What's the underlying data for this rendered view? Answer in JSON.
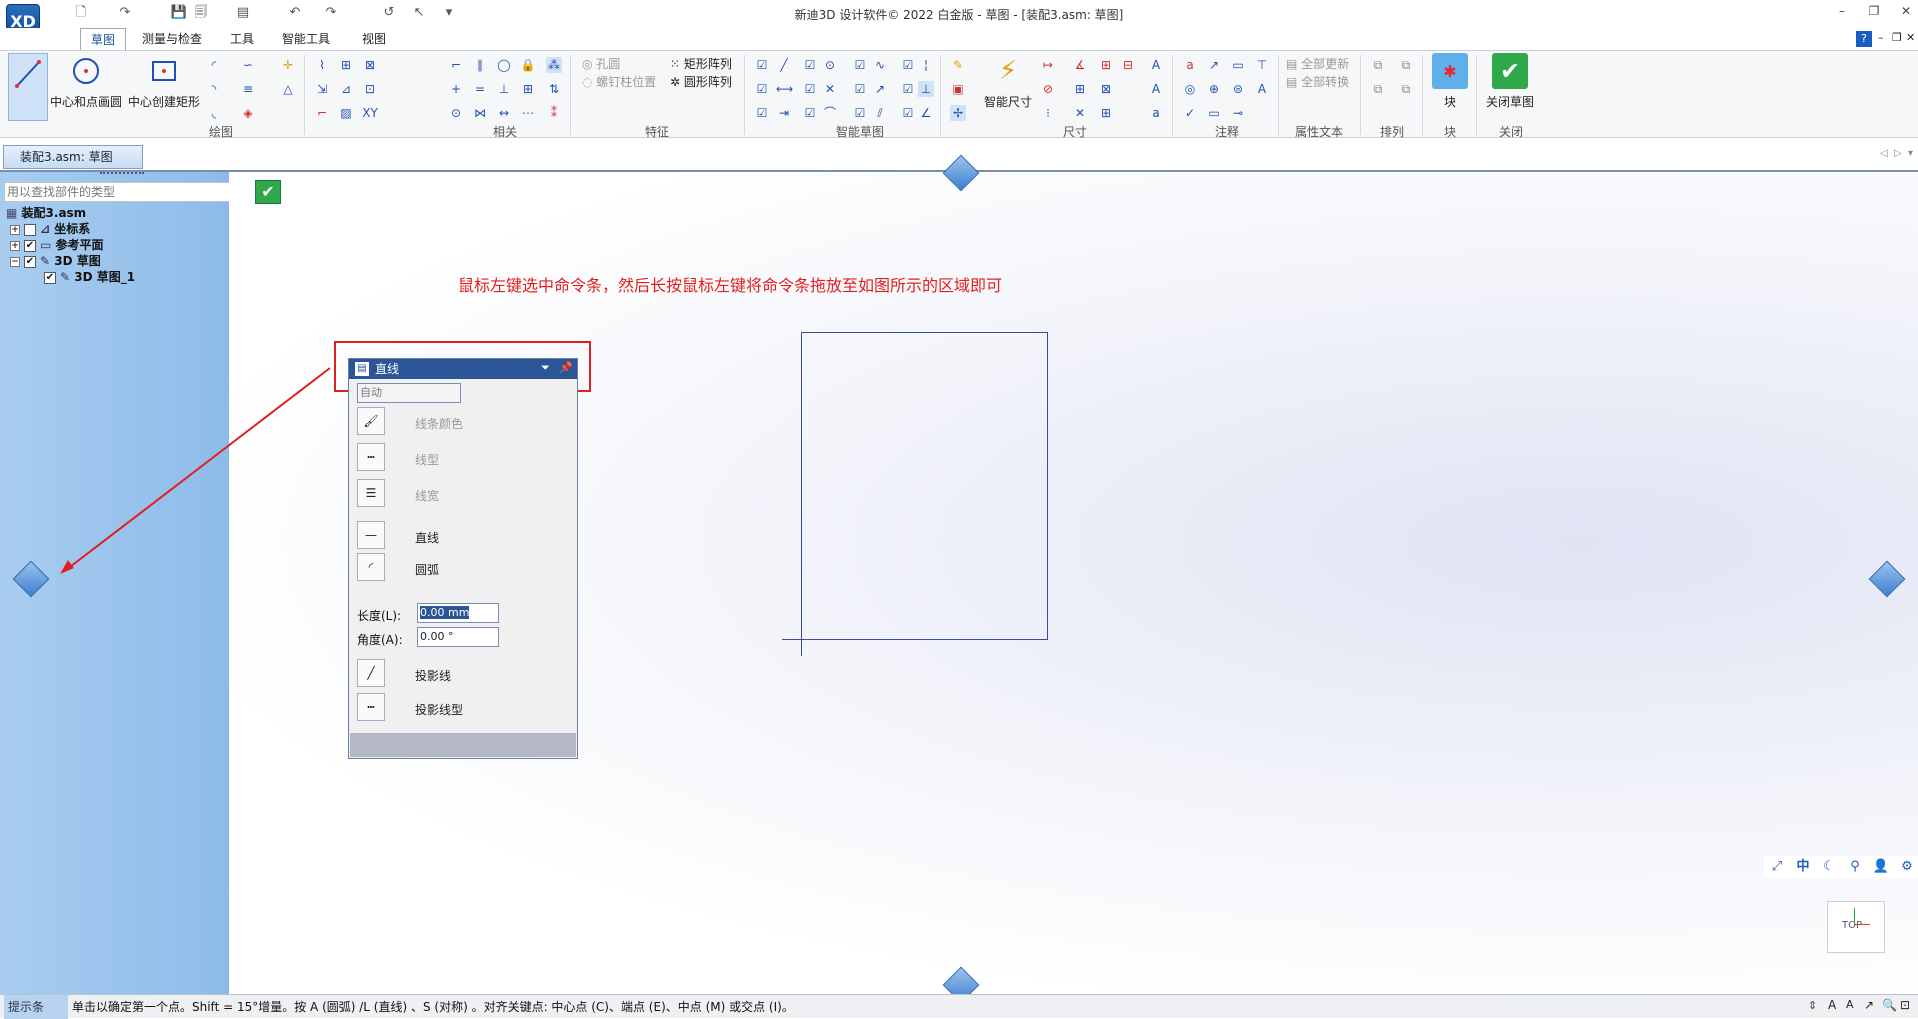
{
  "window": {
    "title": "新迪3D 设计软件© 2022 白金版 - 草图 - [装配3.asm: 草图]",
    "logo_text": "XD"
  },
  "tabs": [
    {
      "label": "草图",
      "active": true
    },
    {
      "label": "测量与检查",
      "active": false
    },
    {
      "label": "工具",
      "active": false
    },
    {
      "label": "智能工具",
      "active": false
    },
    {
      "label": "视图",
      "active": false
    }
  ],
  "ribbon": {
    "groups": {
      "draw": "绘图",
      "relate": "相关",
      "feature": "特征",
      "smart_sketch": "智能草图",
      "dimension": "尺寸",
      "annotation": "注释",
      "attr_text": "属性文本",
      "arrange": "排列",
      "block": "块",
      "close": "关闭"
    },
    "buttons": {
      "center_circle": "中心和点画圆",
      "center_rect": "中心创建矩形",
      "hole": "孔圆",
      "bolt_pos": "螺钉柱位置",
      "rect_array": "矩形阵列",
      "circ_array": "圆形阵列",
      "smart_dim": "智能尺寸",
      "update_all": "全部更新",
      "convert_all": "全部转换",
      "block": "块",
      "close_sketch": "关闭草图"
    }
  },
  "doc_tab": "装配3.asm: 草图",
  "left_panel": {
    "search_placeholder": "用以查找部件的类型",
    "tree": [
      {
        "label": "装配3.asm"
      },
      {
        "label": "坐标系"
      },
      {
        "label": "参考平面"
      },
      {
        "label": "3D 草图"
      },
      {
        "label": "3D 草图_1"
      }
    ]
  },
  "annotation": "鼠标左键选中命令条，然后长按鼠标左键将命令条拖放至如图所示的区域即可",
  "command_bar": {
    "title": "直线",
    "mode_select": "自动",
    "line_color": "线条颜色",
    "line_type": "线型",
    "line_width": "线宽",
    "line": "直线",
    "arc": "圆弧",
    "length_label": "长度(L):",
    "length_value": "0.00 mm",
    "angle_label": "角度(A):",
    "angle_value": "0.00 °",
    "proj_line": "投影线",
    "proj_line_type": "投影线型"
  },
  "view_toolbar": {
    "center_glyph": "中",
    "view_cube_label": "TOP"
  },
  "status": {
    "label": "提示条",
    "text": "单击以确定第一个点。Shift = 15°增量。按 A (圆弧) /L (直线) 、S (对称) 。对齐关键点: 中心点 (C)、端点 (E)、中点 (M) 或交点 (I)。"
  },
  "colors": {
    "annotation": "#e02020",
    "accent": "#2a5597"
  }
}
